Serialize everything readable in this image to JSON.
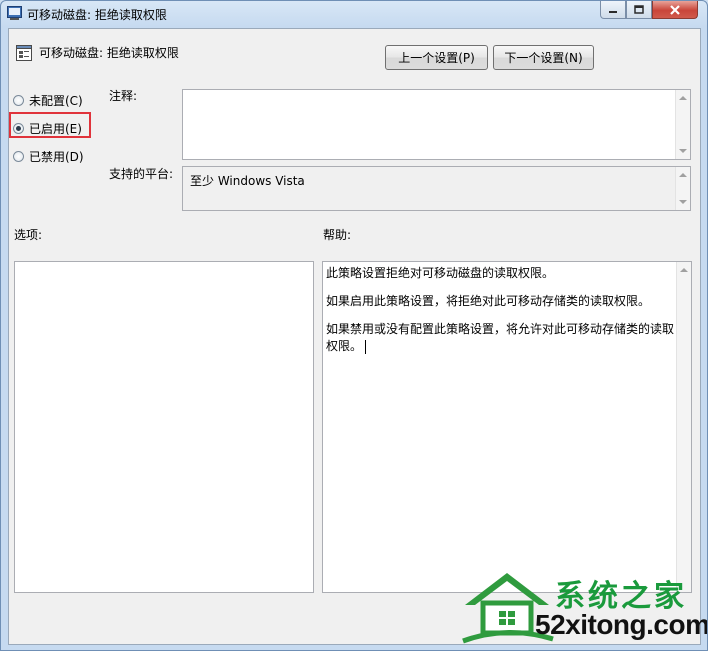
{
  "window": {
    "title": "可移动磁盘: 拒绝读取权限",
    "controls": [
      "minimize-icon",
      "maximize-icon",
      "close-icon"
    ]
  },
  "header": {
    "policy_title": "可移动磁盘: 拒绝读取权限",
    "prev_button": "上一个设置(P)",
    "next_button": "下一个设置(N)"
  },
  "state": {
    "options": [
      {
        "label": "未配置(C)",
        "selected": false
      },
      {
        "label": "已启用(E)",
        "selected": true
      },
      {
        "label": "已禁用(D)",
        "selected": false
      }
    ],
    "highlight_color": "#e0333b"
  },
  "comment": {
    "label": "注释:",
    "value": ""
  },
  "platform": {
    "label": "支持的平台:",
    "value": "至少 Windows Vista"
  },
  "options_panel": {
    "label": "选项:"
  },
  "help_panel": {
    "label": "帮助:",
    "paragraphs": [
      "此策略设置拒绝对可移动磁盘的读取权限。",
      "如果启用此策略设置，将拒绝对此可移动存储类的读取权限。",
      "如果禁用或没有配置此策略设置，将允许对此可移动存储类的读取权限。"
    ]
  },
  "watermark": {
    "title": "系统之家",
    "url": "52xitong.com",
    "color": "#1a9a3c"
  }
}
